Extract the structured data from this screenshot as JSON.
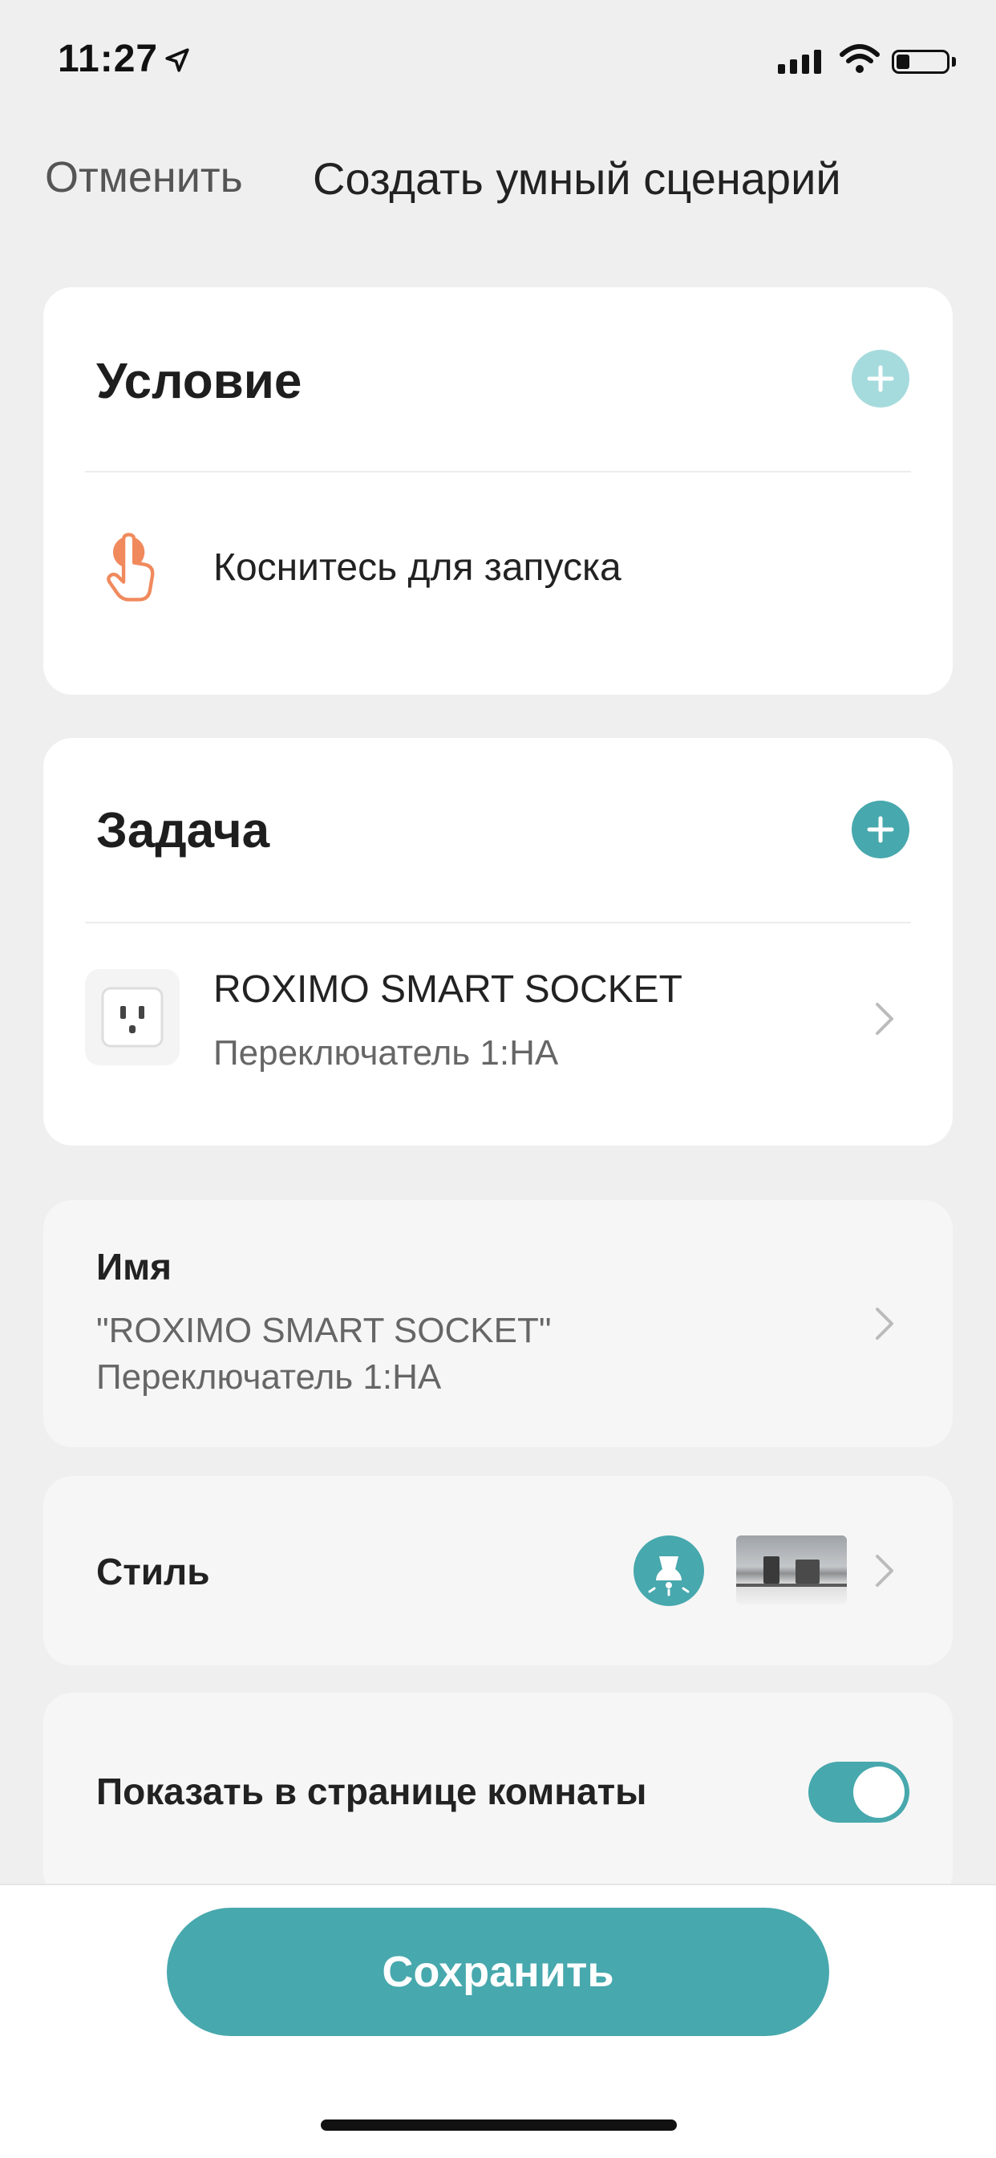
{
  "status_bar": {
    "time": "11:27"
  },
  "header": {
    "cancel_label": "Отменить",
    "title": "Создать умный сценарий"
  },
  "condition": {
    "heading": "Условие",
    "trigger_label": "Коснитесь для запуска"
  },
  "task": {
    "heading": "Задача",
    "device_name": "ROXIMO SMART SOCKET",
    "device_action": "Переключатель 1:НА"
  },
  "name_row": {
    "label": "Имя",
    "value_line1": "\"ROXIMO SMART SOCKET\"",
    "value_line2": "Переключатель 1:НА"
  },
  "style_row": {
    "label": "Стиль"
  },
  "show_in_room": {
    "label": "Показать в странице комнаты",
    "enabled": true
  },
  "footer": {
    "save_label": "Сохранить"
  },
  "colors": {
    "accent": "#47a8ad",
    "accent_light": "#a6dbdd",
    "hand_icon": "#f08a5d"
  }
}
